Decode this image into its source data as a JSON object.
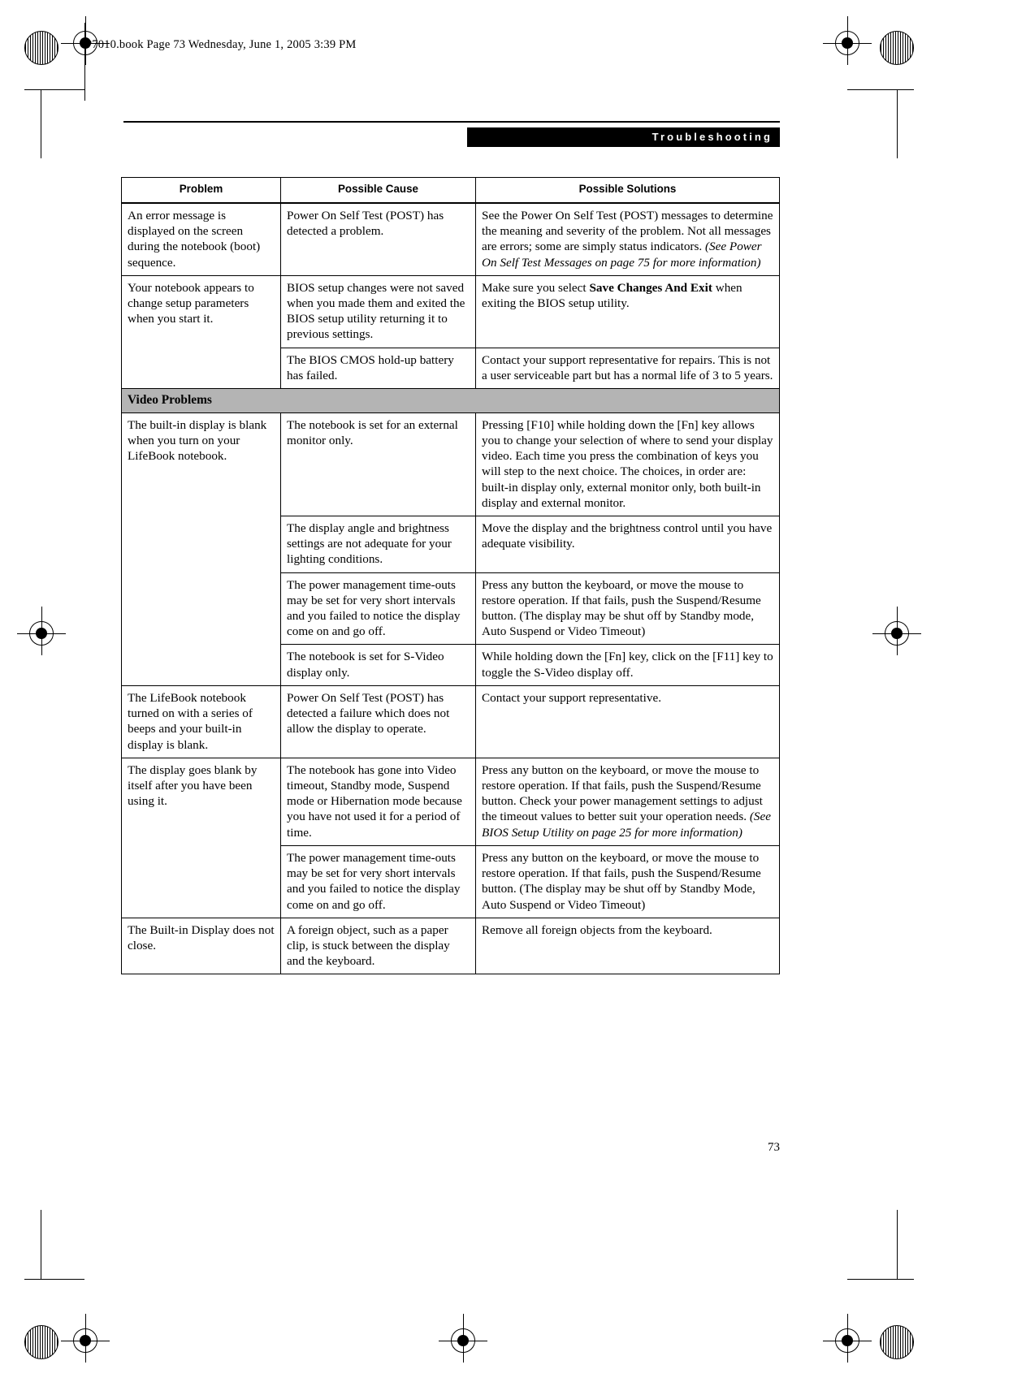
{
  "book_header": "P7010.book  Page 73  Wednesday, June 1, 2005  3:39 PM",
  "chapter_title": "Troubleshooting",
  "page_number": "73",
  "colors": {
    "section_band": "#b4b4b4",
    "chapter_bar": "#000000",
    "text": "#000000"
  },
  "table": {
    "headers": [
      "Problem",
      "Possible Cause",
      "Possible Solutions"
    ],
    "rows": [
      {
        "problem": "An error message is displayed on the screen during the notebook (boot) sequence.",
        "cause": "Power On Self Test (POST) has detected a problem.",
        "solution_plain": "See the Power On Self Test (POST) messages to determine the meaning and severity of the problem. Not all messages are errors; some are simply status indicators. ",
        "solution_italic": "(See Power On Self Test Messages on page 75 for more information)"
      },
      {
        "problem": "Your notebook appears to change setup parameters when you start it.",
        "cause": "BIOS setup changes were not saved when you made them and exited the BIOS setup utility returning it to previous settings.",
        "solution_pre": "Make sure you select ",
        "solution_bold": "Save Changes And Exit",
        "solution_post": " when exiting the BIOS setup utility."
      },
      {
        "problem": "",
        "cause": "The BIOS CMOS hold-up battery has failed.",
        "solution_plain": "Contact your support representative for repairs. This is not a user serviceable part but has a normal life of 3 to 5 years."
      }
    ],
    "section_label": "Video Problems",
    "video_rows": [
      {
        "problem": "The built-in display is blank when you turn on your LifeBook notebook.",
        "cause": "The notebook is set for an external monitor only.",
        "solution_plain": "Pressing [F10] while holding down the [Fn] key allows you to change your selection of where to send your display video. Each time you press the combination of keys you will step to the next choice. The choices, in order are: built-in display only, external monitor only, both built-in display and external monitor."
      },
      {
        "problem": "",
        "cause": "The display angle and brightness settings are not adequate for your lighting conditions.",
        "solution_plain": "Move the display and the brightness control until you have adequate visibility."
      },
      {
        "problem": "",
        "cause": "The power management time-outs may be set for very short intervals and you failed to notice the display come on and go off.",
        "solution_plain": "Press any button the keyboard, or move the mouse to restore operation. If that fails, push the Suspend/Resume button. (The display may be shut off by Standby mode, Auto Suspend or Video Timeout)"
      },
      {
        "problem": "",
        "cause": "The notebook is set for S-Video display only.",
        "solution_plain": "While holding down the [Fn] key, click on the [F11] key to toggle the S-Video display off."
      },
      {
        "problem": "The LifeBook notebook turned on with a series of beeps and your built-in display is blank.",
        "cause": "Power On Self Test (POST) has detected a failure which does not allow the display to operate.",
        "solution_plain": "Contact your support representative."
      },
      {
        "problem": "The display goes blank by itself after you have been using it.",
        "cause": "The notebook has gone into Video timeout, Standby mode, Suspend mode or Hibernation mode because you have not used it for a period of time.",
        "solution_plain": "Press any button on the keyboard, or move the mouse to restore operation. If that fails, push the Suspend/Resume button. Check your power management settings to adjust the timeout values to better suit your operation needs. ",
        "solution_italic": "(See BIOS Setup Utility on page 25 for more information)"
      },
      {
        "problem": "",
        "cause": "The power management time-outs may be set for very short intervals and you failed to notice the display come on and go off.",
        "solution_plain": "Press any button on the keyboard, or move the mouse to restore operation. If that fails, push the Suspend/Resume button. (The display may be shut off by Standby Mode, Auto Suspend or Video Timeout)"
      },
      {
        "problem": "The Built-in Display does not close.",
        "cause": "A foreign object, such as a paper clip, is stuck between the display and the keyboard.",
        "solution_plain": "Remove all foreign objects from the keyboard."
      }
    ]
  }
}
